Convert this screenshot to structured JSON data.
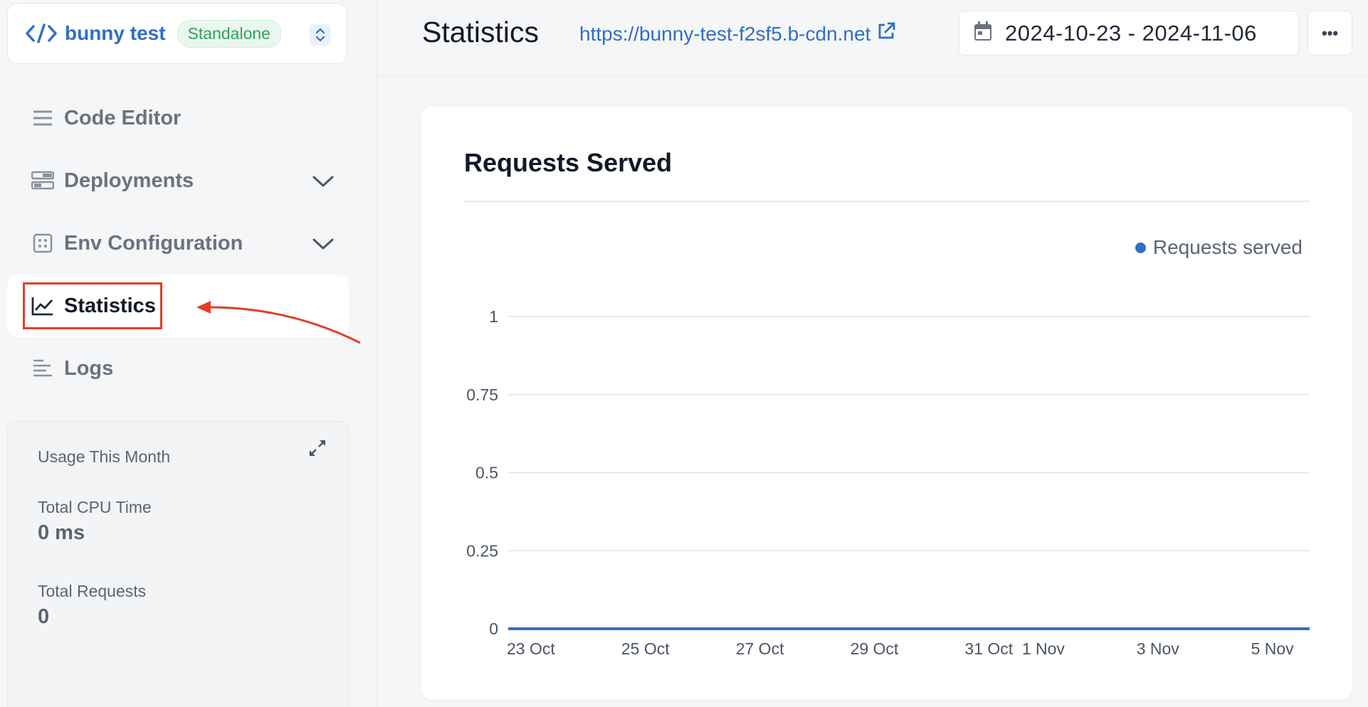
{
  "project": {
    "name": "bunny test",
    "badge": "Standalone"
  },
  "sidebar": {
    "items": [
      {
        "label": "Code Editor",
        "icon": "list-icon"
      },
      {
        "label": "Deployments",
        "icon": "deployments-icon"
      },
      {
        "label": "Env Configuration",
        "icon": "env-config-icon"
      },
      {
        "label": "Statistics",
        "icon": "chart-line-icon"
      },
      {
        "label": "Logs",
        "icon": "logs-icon"
      }
    ]
  },
  "usage": {
    "title": "Usage This Month",
    "cpu_label": "Total CPU Time",
    "cpu_value": "0 ms",
    "requests_label": "Total Requests",
    "requests_value": "0"
  },
  "header": {
    "title": "Statistics",
    "url": "https://bunny-test-f2sf5.b-cdn.net",
    "date_range": "2024-10-23 - 2024-11-06",
    "more_label": "•••"
  },
  "colors": {
    "accent": "#2f6fc4",
    "highlight": "#e23d28"
  },
  "chart_data": {
    "type": "line",
    "title": "Requests Served",
    "series": [
      {
        "name": "Requests served",
        "values": [
          0,
          0,
          0,
          0,
          0,
          0,
          0,
          0,
          0,
          0,
          0,
          0,
          0,
          0,
          0
        ]
      }
    ],
    "x": [
      "2024-10-23",
      "2024-10-24",
      "2024-10-25",
      "2024-10-26",
      "2024-10-27",
      "2024-10-28",
      "2024-10-29",
      "2024-10-30",
      "2024-10-31",
      "2024-11-01",
      "2024-11-02",
      "2024-11-03",
      "2024-11-04",
      "2024-11-05",
      "2024-11-06"
    ],
    "x_ticks": [
      "23 Oct",
      "25 Oct",
      "27 Oct",
      "29 Oct",
      "31 Oct",
      "1 Nov",
      "3 Nov",
      "5 Nov"
    ],
    "y_ticks": [
      "0",
      "0.25",
      "0.5",
      "0.75",
      "1"
    ],
    "ylim": [
      0,
      1
    ],
    "grid": true,
    "legend_position": "top-right"
  }
}
